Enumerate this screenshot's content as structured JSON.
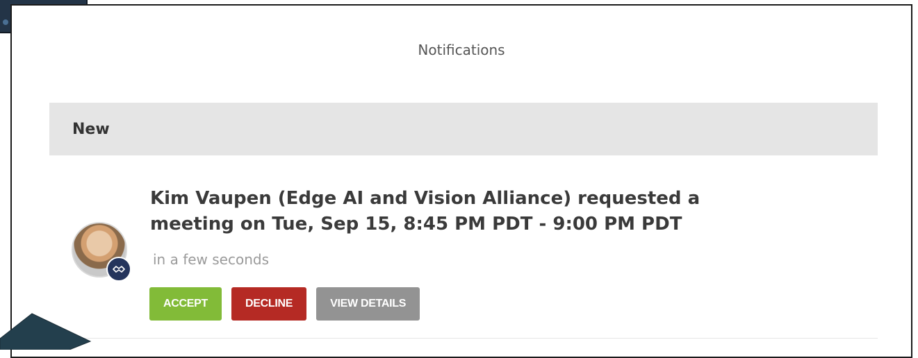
{
  "modal": {
    "title": "Notifications"
  },
  "section": {
    "header": "New"
  },
  "notification": {
    "message_line1": "Kim Vaupen (Edge AI and Vision Alliance) requested a",
    "message_line2": "meeting on Tue, Sep 15, 8:45 PM PDT - 9:00 PM PDT",
    "time": "in a few seconds",
    "actions": {
      "accept": "ACCEPT",
      "decline": "DECLINE",
      "view_details": "VIEW DETAILS"
    }
  },
  "colors": {
    "accept": "#82bb38",
    "decline": "#b52a24",
    "view_details": "#939393",
    "badge": "#24345c",
    "arrow": "#233f4d"
  },
  "icons": {
    "avatar_badge": "meeting-handshake-icon",
    "pointer": "arrow-pointer-icon"
  }
}
